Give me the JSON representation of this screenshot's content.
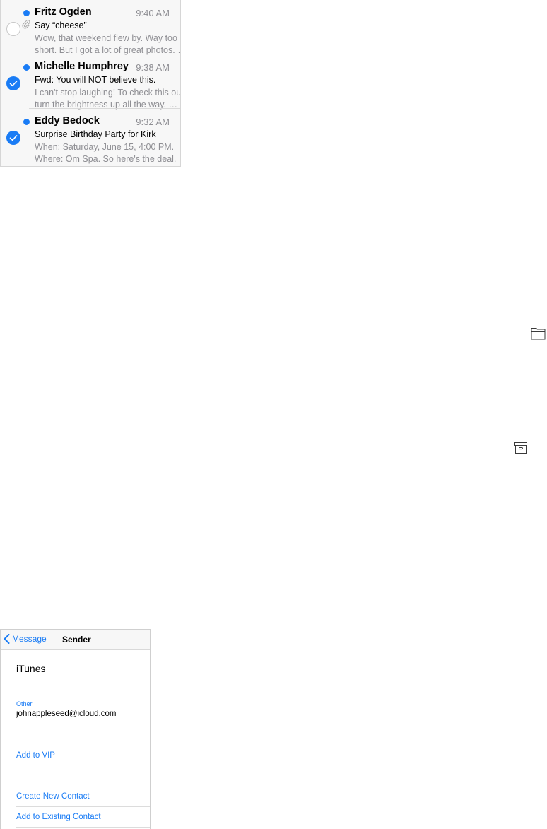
{
  "colors": {
    "accent": "#1a7cf5",
    "secondary_text": "#8e8e93"
  },
  "mail_list": {
    "messages": [
      {
        "sender": "Fritz Ogden",
        "time": "9:40 AM",
        "subject": "Say “cheese”",
        "preview_line1": "Wow, that weekend flew by. Way too",
        "preview_line2": "short. But I got a lot of great photos. …",
        "unread": true,
        "selected": false,
        "has_attachment": true
      },
      {
        "sender": "Michelle Humphrey",
        "time": "9:38 AM",
        "subject": "Fwd: You will NOT believe this.",
        "preview_line1": "I can't stop laughing! To check this out,",
        "preview_line2": "turn the brightness up all the way, …",
        "unread": true,
        "selected": true,
        "has_attachment": false
      },
      {
        "sender": "Eddy Bedock",
        "time": "9:32 AM",
        "subject": "Surprise Birthday Party for Kirk",
        "preview_line1": "When: Saturday, June 15, 4:00 PM.",
        "preview_line2": "Where: Om Spa. So here's the deal. …",
        "unread": true,
        "selected": true,
        "has_attachment": false
      }
    ]
  },
  "icons": {
    "folder": "folder-icon",
    "archive": "archive-box-icon"
  },
  "sender_card": {
    "back_label": "Message",
    "title": "Sender",
    "name": "iTunes",
    "email_label": "Other",
    "email": "johnappleseed@icloud.com",
    "actions": {
      "add_vip": "Add to VIP",
      "create_contact": "Create New Contact",
      "add_existing": "Add to Existing Contact"
    }
  }
}
